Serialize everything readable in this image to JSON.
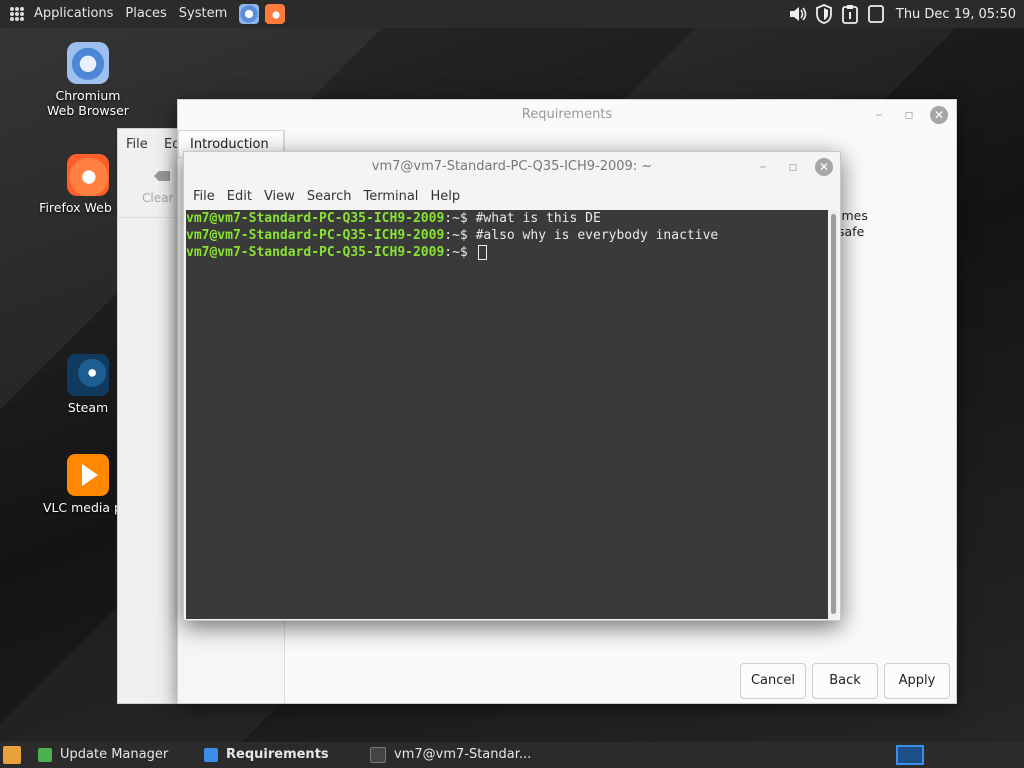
{
  "top_panel": {
    "menus": [
      "Applications",
      "Places",
      "System"
    ],
    "launchers": [
      "chromium-icon",
      "firefox-icon"
    ],
    "tray_icons": [
      "volume-icon",
      "shield-icon",
      "clipboard-icon",
      "battery-icon"
    ],
    "clock": "Thu Dec 19, 05:50"
  },
  "desktop_icons": [
    {
      "label": "Chromium Web Browser",
      "icon": "chromium-icon"
    },
    {
      "label": "Firefox Web Bro",
      "icon": "firefox-icon"
    },
    {
      "label": "Steam",
      "icon": "steam-icon"
    },
    {
      "label": "VLC media pla",
      "icon": "vlc-icon"
    }
  ],
  "background_window": {
    "menu_file": "File",
    "menu_edit": "Ed",
    "clear_label": "Clear"
  },
  "requirements_window": {
    "title": "Requirements",
    "tab": "Introduction",
    "side_text_1": "imes",
    "side_text_2": "safe",
    "buttons": {
      "cancel": "Cancel",
      "back": "Back",
      "apply": "Apply"
    }
  },
  "terminal": {
    "title": "vm7@vm7-Standard-PC-Q35-ICH9-2009: ~",
    "menus": [
      "File",
      "Edit",
      "View",
      "Search",
      "Terminal",
      "Help"
    ],
    "prompt_user": "vm7@vm7-Standard-PC-Q35-ICH9-2009",
    "prompt_path": ":~$ ",
    "lines": [
      "#what is this DE",
      "#also why is everybody inactive",
      ""
    ]
  },
  "taskbar": {
    "tasks": [
      {
        "label": "Update Manager",
        "icon": "update-manager-icon",
        "active": false
      },
      {
        "label": "Requirements",
        "icon": "download-arrow-icon",
        "active": true
      },
      {
        "label": "vm7@vm7-Standar...",
        "icon": "terminal-icon",
        "active": false
      }
    ]
  },
  "colors": {
    "prompt_green": "#8ae234",
    "terminal_bg": "#3a3a3a",
    "panel_bg": "#2b2b2b"
  }
}
